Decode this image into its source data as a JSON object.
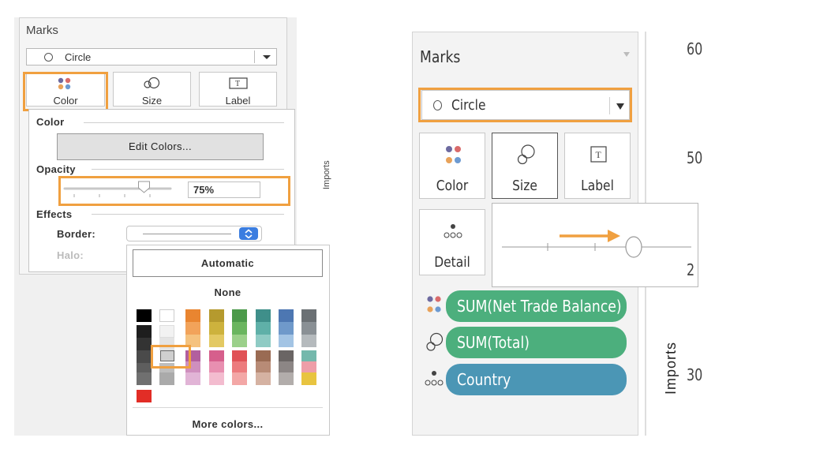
{
  "left": {
    "marks_title": "Marks",
    "mark_type": "Circle",
    "buttons": {
      "color": "Color",
      "size": "Size",
      "label": "Label"
    },
    "popup": {
      "color_section": "Color",
      "edit_colors": "Edit Colors...",
      "opacity_section": "Opacity",
      "opacity_value": "75%",
      "opacity_fraction": 0.75,
      "effects_section": "Effects",
      "border_label": "Border:",
      "halo_label": "Halo:"
    },
    "color_picker": {
      "automatic": "Automatic",
      "none": "None",
      "more_colors": "More colors...",
      "selected_color": "#cfcfcf"
    },
    "side_text": "Imports"
  },
  "right": {
    "marks_title": "Marks",
    "mark_type": "Circle",
    "buttons": {
      "color": "Color",
      "size": "Size",
      "label": "Label",
      "detail": "Detail"
    },
    "pills": [
      {
        "text": "SUM(Net Trade Balance)",
        "icon": "color-dots-icon",
        "color": "#4caf7d"
      },
      {
        "text": "SUM(Total)",
        "icon": "size-icon",
        "color": "#4caf7d"
      },
      {
        "text": "Country",
        "icon": "detail-dots-icon",
        "color": "#4b96b5"
      }
    ],
    "axis_numbers": [
      "60",
      "50",
      "2",
      "30"
    ],
    "axis_label": "Imports"
  },
  "colors": {
    "highlight": "#f0a040",
    "arrow": "#f0a040",
    "green_pill": "#4caf7d",
    "blue_pill": "#4b96b5"
  }
}
